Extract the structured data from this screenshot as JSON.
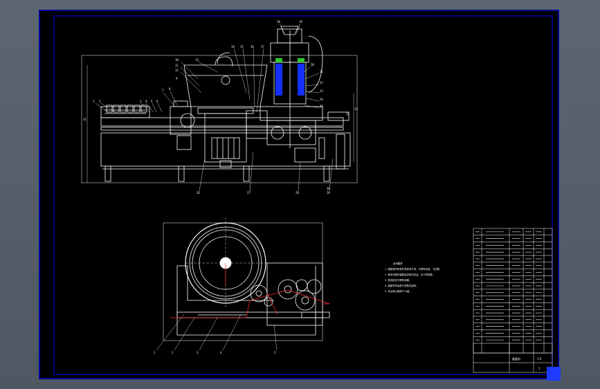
{
  "drawing": {
    "colors": {
      "background": "#000000",
      "outer_frame": "#0000ff",
      "lines": "#ffffff",
      "hatch_blue": "#1430ff",
      "seal_green": "#2ec82e",
      "dimension_red": "#ff3030",
      "workspace": "#56606a"
    },
    "front_view_balloons": [
      "1",
      "2",
      "3",
      "4",
      "5",
      "6",
      "7",
      "8",
      "9",
      "10",
      "11",
      "12",
      "13",
      "14",
      "15",
      "16",
      "17",
      "18",
      "19",
      "20",
      "21",
      "22",
      "23",
      "24",
      "25",
      "26",
      "27",
      "28",
      "29",
      "30",
      "31",
      "32",
      "33"
    ],
    "top_view_balloons": [
      "1",
      "2",
      "3",
      "4",
      "5"
    ],
    "technical_requirements": {
      "heading": "技术要求",
      "lines": [
        "1. 装配前所有零件须清洗干净，不得有毛刺、飞边等。",
        "2. 各传动部件装配后应转动灵活，无卡滞现象。",
        "3. 密封部位不得有渗漏。",
        "4. 装配完毕后进行空载试运转。",
        "5. 未注明公差按IT12级。"
      ]
    },
    "title_block": {
      "drawing_title": "旋盖机",
      "scale": "1:5",
      "sheet": "1",
      "parts_rows": 17
    }
  }
}
